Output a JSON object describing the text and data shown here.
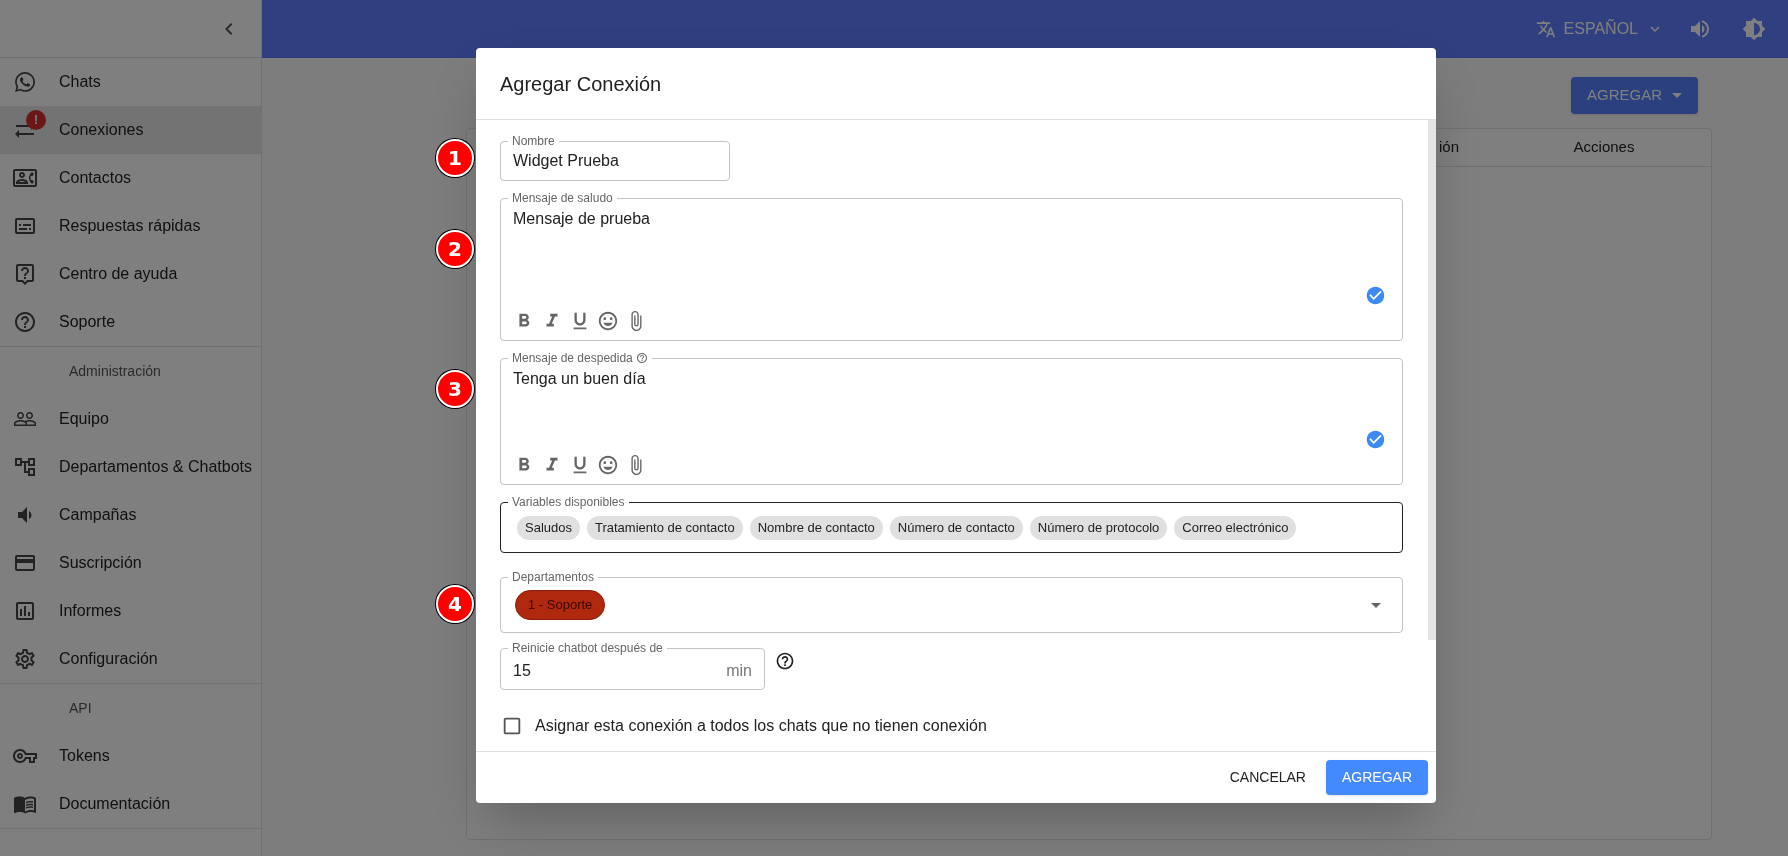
{
  "sidebar": {
    "groups": [
      {
        "items": [
          {
            "label": "Chats",
            "selected": false
          },
          {
            "label": "Conexiones",
            "selected": true,
            "badge": "!"
          },
          {
            "label": "Contactos",
            "selected": false
          },
          {
            "label": "Respuestas rápidas",
            "selected": false
          },
          {
            "label": "Centro de ayuda",
            "selected": false
          },
          {
            "label": "Soporte",
            "selected": false
          }
        ]
      },
      {
        "heading": "Administración",
        "items": [
          {
            "label": "Equipo",
            "selected": false
          },
          {
            "label": "Departamentos & Chatbots",
            "selected": false
          },
          {
            "label": "Campañas",
            "selected": false
          },
          {
            "label": "Suscripción",
            "selected": false
          },
          {
            "label": "Informes",
            "selected": false
          },
          {
            "label": "Configuración",
            "selected": false
          }
        ]
      },
      {
        "heading": "API",
        "items": [
          {
            "label": "Tokens",
            "selected": false
          },
          {
            "label": "Documentación",
            "selected": false
          }
        ]
      }
    ]
  },
  "top_bar": {
    "language": "ESPAÑOL"
  },
  "page": {
    "add_button": "AGREGAR",
    "table": {
      "columns": [
        "ión",
        "Acciones"
      ]
    }
  },
  "dialog": {
    "title": "Agregar Conexión",
    "name": {
      "label": "Nombre",
      "value": "Widget Prueba"
    },
    "greeting": {
      "label": "Mensaje de saludo",
      "value": "Mensaje de prueba"
    },
    "farewell": {
      "label": "Mensaje de despedida",
      "value": "Tenga un buen día"
    },
    "variables": {
      "label": "Variables disponibles",
      "chips": [
        "Saludos",
        "Tratamiento de contacto",
        "Nombre de contacto",
        "Número de contacto",
        "Número de protocolo",
        "Correo electrónico"
      ]
    },
    "departments": {
      "label": "Departamentos",
      "chips": [
        {
          "label": "1 - Soporte",
          "color": "#b0290f"
        }
      ]
    },
    "reset": {
      "label": "Reinicie chatbot después de",
      "value": "15",
      "unit": "min"
    },
    "assign": {
      "label": "Asignar esta conexión a todos los chats que no tienen conexión",
      "checked": false
    },
    "buttons": {
      "cancel": "CANCELAR",
      "submit": "AGREGAR"
    }
  },
  "markers": [
    "1",
    "2",
    "3",
    "4"
  ]
}
